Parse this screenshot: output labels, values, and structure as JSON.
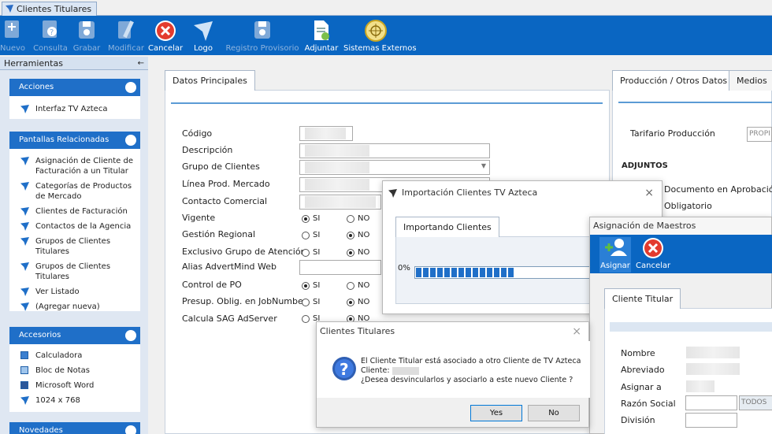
{
  "document_tab": {
    "title": "Clientes Titulares"
  },
  "toolbar": [
    {
      "label": "Nuevo",
      "icon": "new-doc-icon",
      "enabled": false
    },
    {
      "label": "Consulta",
      "icon": "query-icon",
      "enabled": false
    },
    {
      "label": "Grabar",
      "icon": "save-icon",
      "enabled": false
    },
    {
      "label": "Modificar",
      "icon": "edit-icon",
      "enabled": false
    },
    {
      "label": "Cancelar",
      "icon": "cancel-icon",
      "enabled": true
    },
    {
      "label": "Logo",
      "icon": "logo-icon",
      "enabled": true
    },
    {
      "label": "Registro Provisorio",
      "icon": "save-icon",
      "enabled": false
    },
    {
      "label": "Adjuntar",
      "icon": "attach-icon",
      "enabled": true
    },
    {
      "label": "Sistemas Externos",
      "icon": "globe-icon",
      "enabled": true
    }
  ],
  "tools_pane": {
    "title": "Herramientas",
    "pin": "←"
  },
  "panels": {
    "acciones": {
      "title": "Acciones",
      "items": [
        "Interfaz TV Azteca"
      ]
    },
    "pantallas": {
      "title": "Pantallas Relacionadas",
      "items": [
        "Asignación de Cliente de Facturación a un Titular",
        "Categorías de Productos de Mercado",
        "Clientes de Facturación",
        "Contactos de la Agencia",
        "Grupos de Clientes Titulares",
        "Grupos de Clientes Titulares",
        "Ver Listado",
        "(Agregar nueva)"
      ]
    },
    "accesorios": {
      "title": "Accesorios",
      "items": [
        "Calculadora",
        "Bloc de Notas",
        "Microsoft Word",
        "1024 x 768"
      ]
    },
    "novedades": {
      "title": "Novedades"
    }
  },
  "main": {
    "tab": "Datos Principales",
    "fields": [
      "Código",
      "Descripción",
      "Grupo de Clientes",
      "Línea Prod. Mercado",
      "Contacto Comercial"
    ],
    "radios": [
      {
        "label": "Vigente",
        "si": true
      },
      {
        "label": "Gestión Regional",
        "si": false
      },
      {
        "label": "Exclusivo Grupo de Atención",
        "si": false
      },
      {
        "label": "Alias AdvertMind Web",
        "si": null
      },
      {
        "label": "Control de PO",
        "si": true
      },
      {
        "label": "Presup. Oblig. en JobNumber",
        "si": false
      },
      {
        "label": "Calcula SAG AdServer",
        "si": false
      }
    ],
    "si_label": "SI",
    "no_label": "NO"
  },
  "right": {
    "tabs": [
      "Producción / Otros Datos",
      "Medios"
    ],
    "tarifario_label": "Tarifario Producción",
    "tarifario_value": "PROPI",
    "adjuntos": "ADJUNTOS",
    "doc_aprob": "Documento en Aprobación",
    "obligatorio": "Obligatorio"
  },
  "import_dialog": {
    "title": "Importación Clientes TV Azteca",
    "tab": "Importando Clientes",
    "progress_label": "0%",
    "progress": 0.55
  },
  "asignacion": {
    "title": "Asignación de Maestros",
    "buttons": [
      "Asignar",
      "Cancelar"
    ],
    "tab": "Cliente Titular",
    "fields": [
      "Nombre",
      "Abreviado",
      "Asignar a",
      "Razón Social",
      "División"
    ],
    "todos": "TODOS"
  },
  "msgbox": {
    "title": "Clientes Titulares",
    "line1": "El Cliente Titular está asociado a otro Cliente de TV Azteca",
    "line2": "Cliente:",
    "line3": "¿Desea desvincularlos y asociarlo a este nuevo Cliente ?",
    "yes": "Yes",
    "no": "No"
  }
}
